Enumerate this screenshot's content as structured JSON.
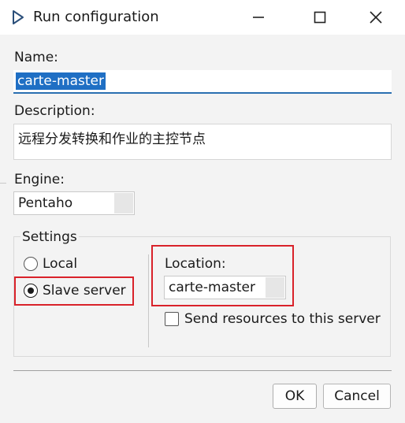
{
  "window": {
    "title": "Run configuration",
    "icon": "play-triangle-icon",
    "controls": [
      "minimize-icon",
      "maximize-icon",
      "close-icon"
    ]
  },
  "form": {
    "name_label": "Name:",
    "name_value": "carte-master",
    "description_label": "Description:",
    "description_value": "远程分发转换和作业的主控节点",
    "engine_label": "Engine:",
    "engine_value": "Pentaho"
  },
  "settings": {
    "label": "Settings",
    "local_label": "Local",
    "slave_label": "Slave server",
    "selected": "slave",
    "location_label": "Location:",
    "location_value": "carte-master",
    "send_resources_label": "Send resources to this server",
    "send_resources_checked": false
  },
  "buttons": {
    "ok": "OK",
    "cancel": "Cancel"
  },
  "colors": {
    "highlight_border": "#d9222a",
    "selection_bg": "#1f6fc4",
    "field_underline": "#2a6fb0"
  }
}
